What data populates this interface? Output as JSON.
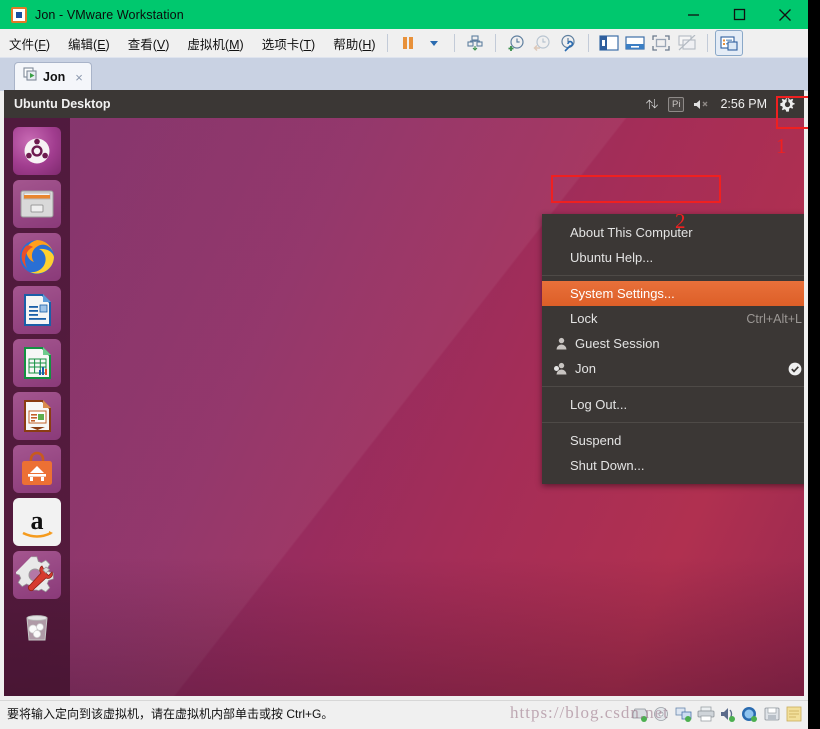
{
  "window": {
    "title": "Jon - VMware Workstation",
    "icon": "vmware-vm-icon",
    "controls": [
      {
        "name": "minimize-button",
        "glyph": "minimize-icon"
      },
      {
        "name": "maximize-button",
        "glyph": "maximize-icon"
      },
      {
        "name": "close-button",
        "glyph": "close-icon"
      }
    ]
  },
  "menubar": {
    "items": [
      {
        "label": "文件",
        "accel": "F"
      },
      {
        "label": "编辑",
        "accel": "E"
      },
      {
        "label": "查看",
        "accel": "V"
      },
      {
        "label": "虚拟机",
        "accel": "M"
      },
      {
        "label": "选项卡",
        "accel": "T"
      },
      {
        "label": "帮助",
        "accel": "H"
      }
    ]
  },
  "toolbar": {
    "items": [
      {
        "name": "suspend-button",
        "icon": "pause-icon"
      },
      {
        "name": "power-dropdown",
        "icon": "chevron-down-icon"
      },
      {
        "name": "snapshot-manager-button",
        "icon": "snapshot-icon"
      },
      {
        "name": "take-snapshot-button",
        "icon": "clock-plus-icon"
      },
      {
        "name": "revert-snapshot-button",
        "icon": "clock-back-icon"
      },
      {
        "name": "manage-snapshots-button",
        "icon": "clock-wrench-icon"
      },
      {
        "name": "show-sidebar-button",
        "icon": "sidebar-icon"
      },
      {
        "name": "show-console-button",
        "icon": "console-icon"
      },
      {
        "name": "fullscreen-button",
        "icon": "fullscreen-icon"
      },
      {
        "name": "unity-mode-button",
        "icon": "unity-mode-icon"
      },
      {
        "name": "preferences-button",
        "icon": "window-preferences-icon"
      }
    ]
  },
  "tabs": [
    {
      "label": "Jon",
      "icon": "vm-tab-icon",
      "close": "×",
      "active": true
    }
  ],
  "guest": {
    "panel": {
      "title": "Ubuntu Desktop",
      "indicators": {
        "network": "network-updown-icon",
        "pi_label": "Pi",
        "volume": "volume-muted-icon",
        "clock": "2:56 PM",
        "gear": "gear-icon"
      }
    },
    "launcher": {
      "items": [
        {
          "name": "launcher-item-dash",
          "label": "Ubuntu Dash",
          "icon": "ubuntu-logo-icon"
        },
        {
          "name": "launcher-item-files",
          "label": "Files",
          "icon": "file-cabinet-icon"
        },
        {
          "name": "launcher-item-firefox",
          "label": "Firefox",
          "icon": "firefox-icon"
        },
        {
          "name": "launcher-item-writer",
          "label": "LibreOffice Writer",
          "icon": "writer-icon"
        },
        {
          "name": "launcher-item-calc",
          "label": "LibreOffice Calc",
          "icon": "calc-icon"
        },
        {
          "name": "launcher-item-impress",
          "label": "LibreOffice Impress",
          "icon": "impress-icon"
        },
        {
          "name": "launcher-item-software",
          "label": "Ubuntu Software",
          "icon": "software-bag-icon"
        },
        {
          "name": "launcher-item-amazon",
          "label": "Amazon",
          "icon": "amazon-icon"
        },
        {
          "name": "launcher-item-settings",
          "label": "System Settings",
          "icon": "gear-wrench-icon"
        },
        {
          "name": "launcher-item-trash",
          "label": "Trash",
          "icon": "trash-icon"
        }
      ]
    },
    "session_menu": {
      "items": [
        {
          "type": "item",
          "label": "About This Computer",
          "accel": "",
          "icon": "",
          "name": "menu-item-about-this-computer"
        },
        {
          "type": "item",
          "label": "Ubuntu Help...",
          "accel": "",
          "icon": "",
          "name": "menu-item-ubuntu-help"
        },
        {
          "type": "separator"
        },
        {
          "type": "item",
          "label": "System Settings...",
          "accel": "",
          "icon": "",
          "highlight": true,
          "name": "menu-item-system-settings"
        },
        {
          "type": "item",
          "label": "Lock",
          "accel": "Ctrl+Alt+L",
          "icon": "",
          "name": "menu-item-lock"
        },
        {
          "type": "item",
          "label": "Guest Session",
          "accel": "",
          "icon": "user-icon",
          "name": "menu-item-guest-session"
        },
        {
          "type": "item",
          "label": "Jon",
          "accel": "",
          "icon": "user-icon",
          "bullet": true,
          "check": true,
          "name": "menu-item-jon"
        },
        {
          "type": "separator"
        },
        {
          "type": "item",
          "label": "Log Out...",
          "accel": "",
          "icon": "",
          "name": "menu-item-log-out"
        },
        {
          "type": "separator"
        },
        {
          "type": "item",
          "label": "Suspend",
          "accel": "",
          "icon": "",
          "name": "menu-item-suspend"
        },
        {
          "type": "item",
          "label": "Shut Down...",
          "accel": "",
          "icon": "",
          "name": "menu-item-shut-down"
        }
      ]
    }
  },
  "annotations": [
    {
      "name": "annotation-step-1",
      "number": "1"
    },
    {
      "name": "annotation-step-2",
      "number": "2"
    }
  ],
  "statusbar": {
    "text": "要将输入定向到该虚拟机，请在虚拟机内部单击或按 Ctrl+G。",
    "icons": [
      {
        "name": "status-harddisk-icon"
      },
      {
        "name": "status-cdrom-icon"
      },
      {
        "name": "status-network-icon"
      },
      {
        "name": "status-printer-icon"
      },
      {
        "name": "status-sound-icon"
      },
      {
        "name": "status-usb-icon"
      },
      {
        "name": "status-floppy-icon"
      },
      {
        "name": "status-notes-icon"
      }
    ]
  },
  "watermark": {
    "text": "https://blog.csdn.net"
  },
  "colors": {
    "titlebar": "#00c86e",
    "ubuntu_orange": "#e8703a",
    "panel_dark": "#3b3735",
    "annotation_red": "#f02020",
    "wallpaper_purple": "#7b2a66",
    "wallpaper_magenta": "#a52d57"
  }
}
